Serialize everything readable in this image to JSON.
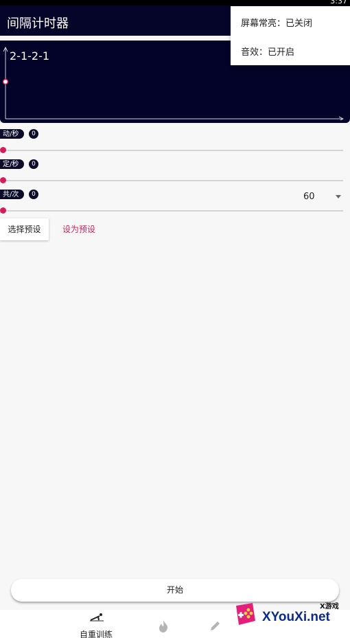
{
  "status": {
    "time": "3:37"
  },
  "appbar": {
    "title": "间隔计时器"
  },
  "menu": {
    "items": [
      {
        "label": "屏幕常亮：已关闭"
      },
      {
        "label": "音效：已开启"
      }
    ]
  },
  "display": {
    "pattern": "2-1-2-1"
  },
  "sliders": [
    {
      "label": "动/秒",
      "count": "0"
    },
    {
      "label": "定/秒",
      "count": "0"
    },
    {
      "label": "共/次",
      "count": "0"
    }
  ],
  "count_select": {
    "value": "60"
  },
  "preset": {
    "choose_label": "选择预设",
    "set_label": "设为预设"
  },
  "start_label": "开始",
  "bottom_nav": {
    "items": [
      {
        "label": "自重训练",
        "icon": "pushup-icon"
      },
      {
        "label": "",
        "icon": "flame-icon"
      },
      {
        "label": "",
        "icon": "pencil-icon"
      }
    ]
  },
  "watermark": {
    "small": "X游戏",
    "big": "XYouXi.net"
  },
  "colors": {
    "accent": "#d21f5a",
    "navy": "#05052a"
  }
}
